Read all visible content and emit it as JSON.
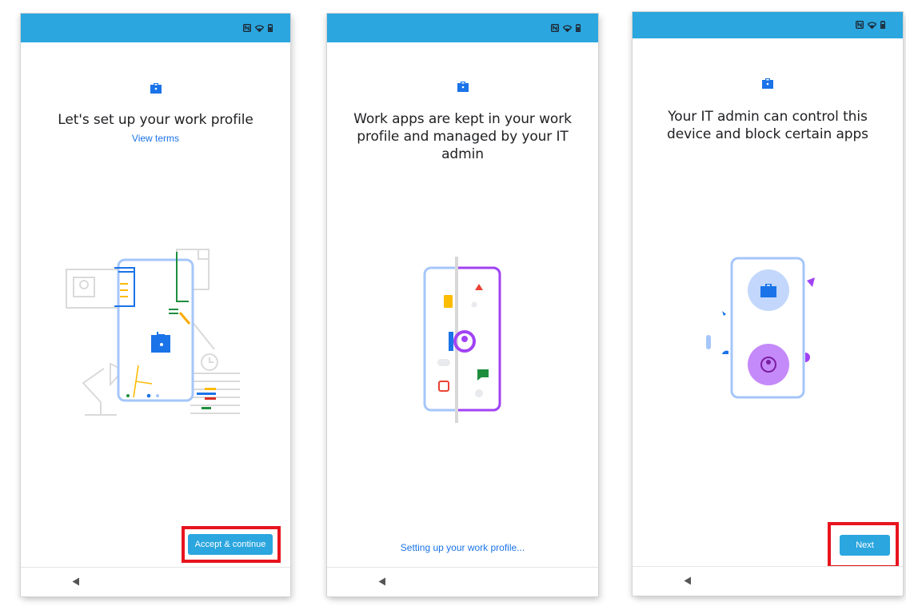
{
  "screens": [
    {
      "title": "Let's set up your work profile",
      "link": "View terms",
      "button": "Accept & continue"
    },
    {
      "title": "Work apps are kept in your work profile and managed by your IT admin",
      "status_text": "Setting up your work profile..."
    },
    {
      "title": "Your IT admin can control this device and block certain apps",
      "button": "Next"
    }
  ],
  "colors": {
    "status_bar": "#2ba6df",
    "accent": "#1a73e8",
    "highlight": "#e8141e",
    "work_purple": "#a142f4"
  },
  "icons": [
    "nfc-icon",
    "wifi-icon",
    "battery-icon",
    "briefcase-icon",
    "back-icon",
    "work-profile-icon",
    "personal-profile-icon"
  ]
}
